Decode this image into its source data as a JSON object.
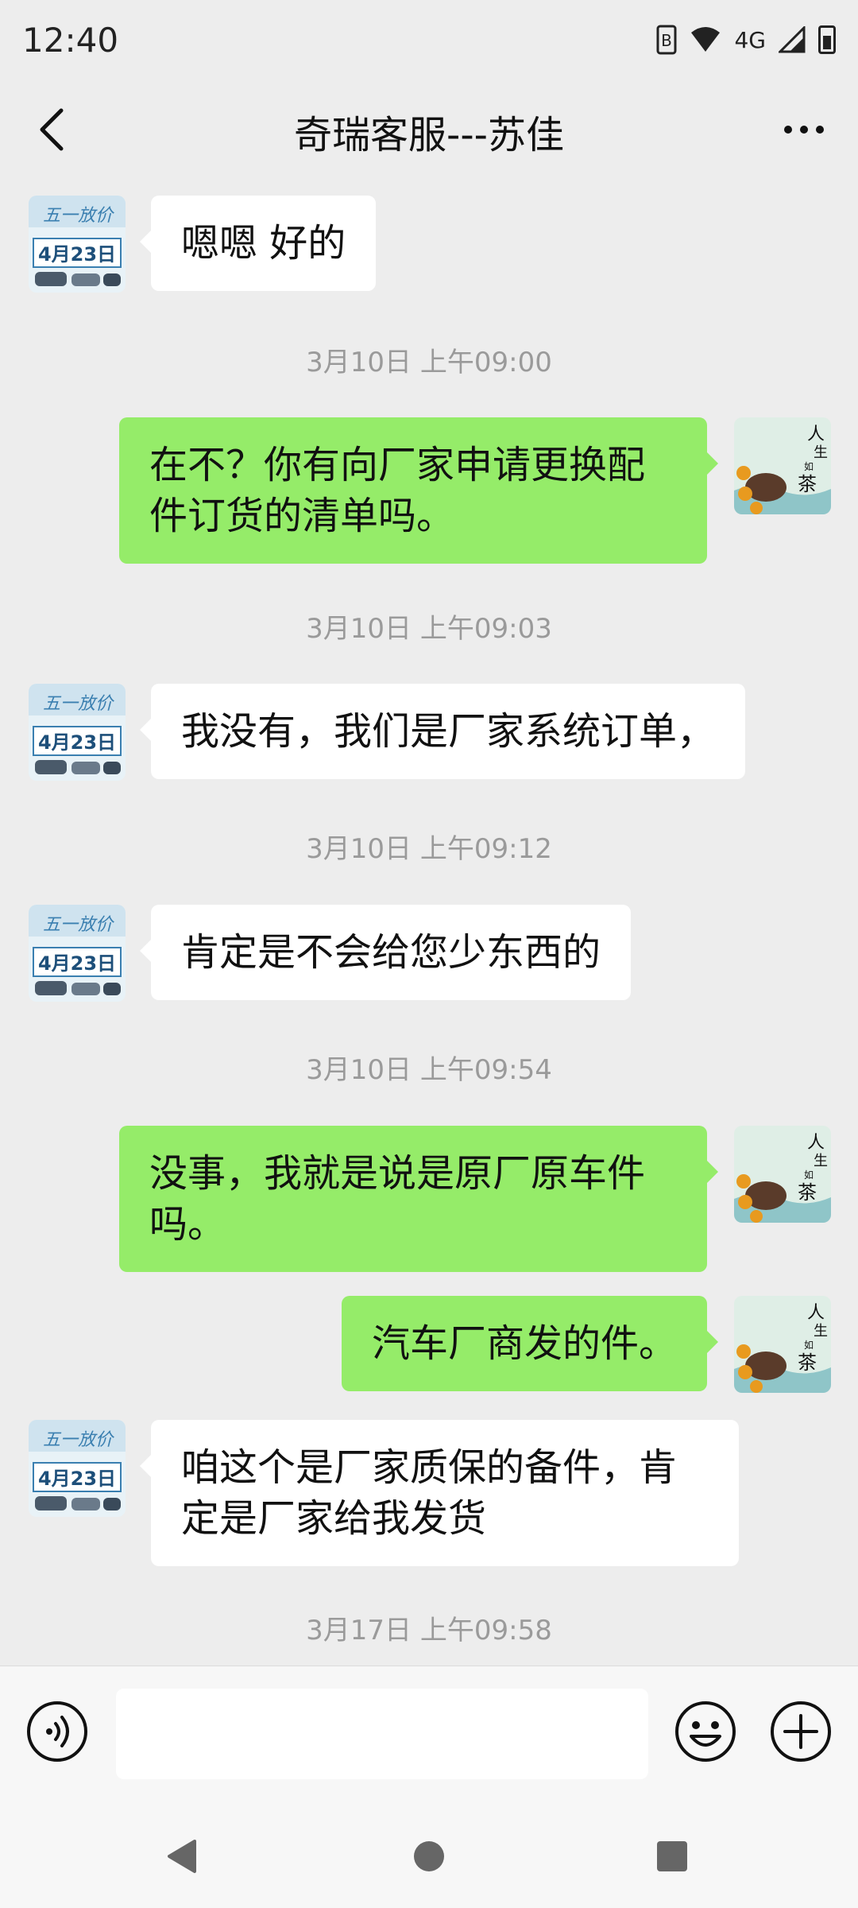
{
  "status_bar": {
    "time": "12:40",
    "network": "4G"
  },
  "header": {
    "title": "奇瑞客服---苏佳"
  },
  "messages": [
    {
      "side": "left",
      "lines": [
        "嗯嗯  好的"
      ]
    },
    {
      "timestamp": "3月10日 上午09:00"
    },
    {
      "side": "right",
      "lines": [
        "在不？你有向厂家申请更换配",
        "件订货的清单吗。"
      ]
    },
    {
      "timestamp": "3月10日 上午09:03"
    },
    {
      "side": "left",
      "lines": [
        "我没有，我们是厂家系统订单，"
      ]
    },
    {
      "timestamp": "3月10日 上午09:12"
    },
    {
      "side": "left",
      "lines": [
        "肯定是不会给您少东西的"
      ]
    },
    {
      "timestamp": "3月10日 上午09:54"
    },
    {
      "side": "right",
      "lines": [
        "没事，我就是说是原厂原车件",
        "吗。"
      ]
    },
    {
      "side": "right",
      "lines": [
        "汽车厂商发的件。"
      ]
    },
    {
      "side": "left",
      "lines": [
        "咱这个是厂家质保的备件，肯",
        "定是厂家给我发货"
      ]
    },
    {
      "timestamp": "3月17日 上午09:58"
    }
  ],
  "avatars": {
    "contact": {
      "banner": "五一放价",
      "date": "4月23日",
      "colors": {
        "bg": "#e8f2f7",
        "accent": "#3a7fb0"
      }
    },
    "self": {
      "glyphs": [
        "人",
        "生",
        "如",
        "茶"
      ],
      "colors": {
        "bg": "#dfeee6",
        "teapot": "#5a3b2a",
        "orange": "#e89a1f"
      }
    }
  },
  "input_bar": {
    "value": "",
    "placeholder": ""
  },
  "colors": {
    "green_bubble": "#95ec69",
    "white_bubble": "#ffffff",
    "background": "#ededed",
    "timestamp": "#9a9a9a"
  }
}
